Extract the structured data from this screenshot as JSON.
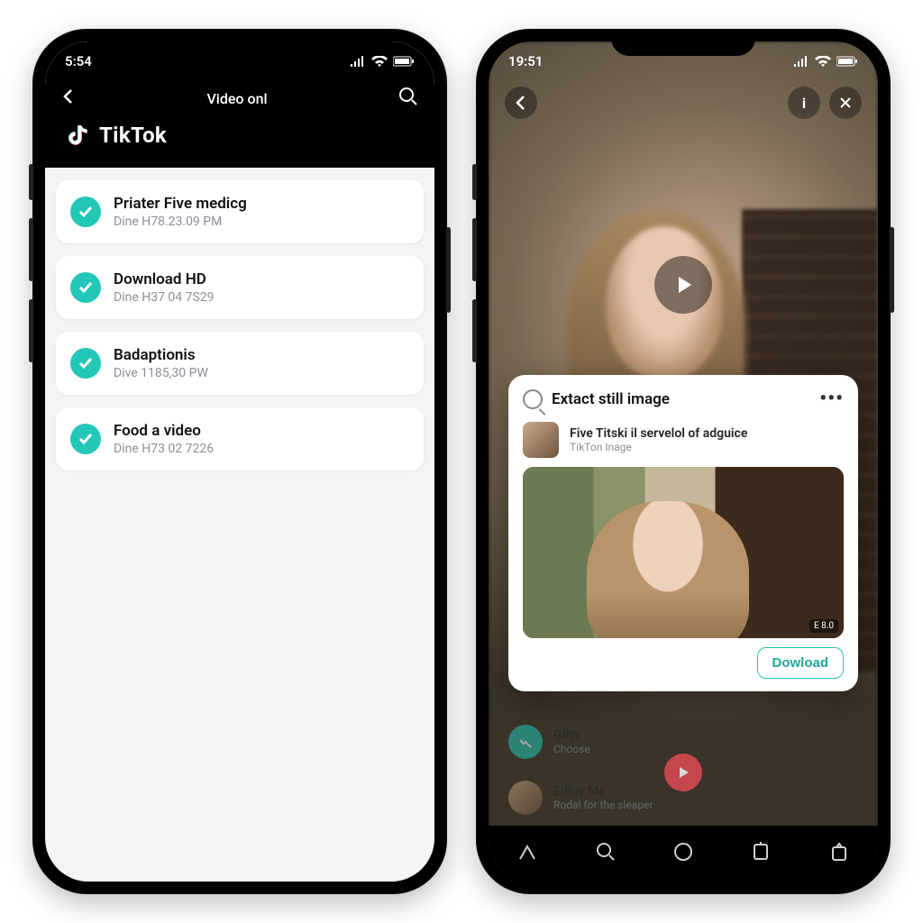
{
  "left": {
    "status_time": "5:54",
    "nav_title": "Video onl",
    "brand": "TikTok",
    "items": [
      {
        "title": "Priater Five medicg",
        "meta": "Dine H78.23.09 PM"
      },
      {
        "title": "Download HD",
        "meta": "Dine H37 04 7S29"
      },
      {
        "title": "Badaptionis",
        "meta": "Dive 1185,30 PW"
      },
      {
        "title": "Food a video",
        "meta": "Dine H73 02 7226"
      }
    ]
  },
  "right": {
    "status_time": "19:51",
    "sheet": {
      "title": "Extact still image",
      "item_title": "Five Titski il servelol of adguice",
      "item_sub": "TikTon Inage",
      "thumb_badge": "E 8.0",
      "download_label": "Dowload"
    },
    "behind": {
      "row1_title": "Gifts",
      "row1_sub": "Choose",
      "row2_title": "Edtoy Me",
      "row2_sub": "Rodal for the sleaper"
    }
  },
  "icons": {
    "back": "back-icon",
    "search": "search-icon",
    "close": "close-icon",
    "more": "more-icon",
    "play": "play-icon",
    "signal": "signal-icon",
    "wifi": "wifi-icon",
    "battery": "battery-icon"
  }
}
